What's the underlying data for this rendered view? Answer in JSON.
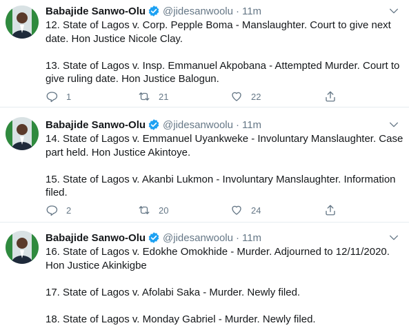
{
  "colors": {
    "accent": "#1da1f2",
    "text": "#14171a",
    "muted": "#657786",
    "border": "#e6ecf0"
  },
  "tweets": [
    {
      "name": "Babajide Sanwo-Olu",
      "handle": "@jidesanwoolu",
      "separator": "·",
      "time": "11m",
      "paragraphs": [
        "12. State of Lagos v. Corp. Pepple Boma - Manslaughter. Court to give next date. Hon Justice Nicole Clay.",
        "13. State of Lagos v. Insp. Emmanuel Akpobana - Attempted Murder. Court to give ruling date. Hon Justice Balogun."
      ],
      "replies": "1",
      "retweets": "21",
      "likes": "22"
    },
    {
      "name": "Babajide Sanwo-Olu",
      "handle": "@jidesanwoolu",
      "separator": "·",
      "time": "11m",
      "paragraphs": [
        "14. State of Lagos v. Emmanuel Uyankweke - Involuntary Manslaughter. Case part held. Hon Justice Akintoye.",
        "15. State of Lagos v. Akanbi Lukmon - Involuntary Manslaughter. Information filed."
      ],
      "replies": "2",
      "retweets": "20",
      "likes": "24"
    },
    {
      "name": "Babajide Sanwo-Olu",
      "handle": "@jidesanwoolu",
      "separator": "·",
      "time": "11m",
      "paragraphs": [
        "16. State of Lagos v. Edokhe Omokhide - Murder. Adjourned to 12/11/2020. Hon Justice Akinkigbe",
        "17. State of Lagos v. Afolabi Saka - Murder. Newly filed.",
        "18. State of Lagos v. Monday Gabriel - Murder. Newly filed."
      ]
    }
  ]
}
